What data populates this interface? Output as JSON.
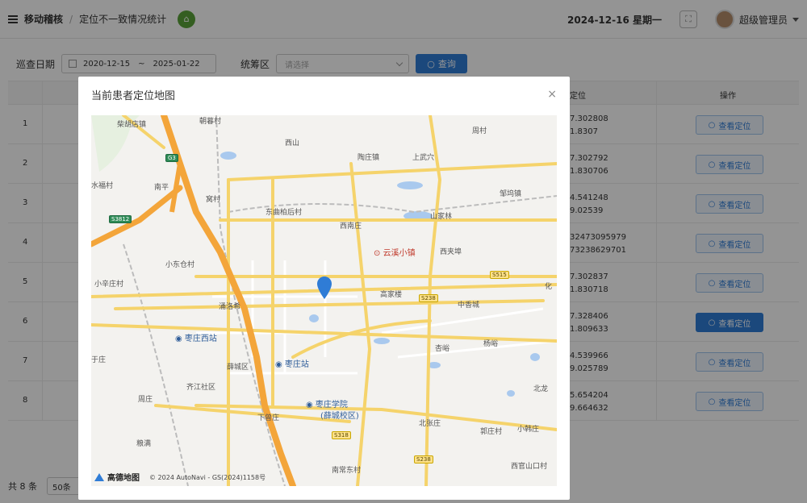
{
  "header": {
    "menu_label": "移动稽核",
    "breadcrumb_current": "定位不一致情况统计",
    "date": "2024-12-16 星期一",
    "user": "超级管理员"
  },
  "filters": {
    "date_label": "巡查日期",
    "date_start": "2020-12-15",
    "date_sep": "~",
    "date_end": "2025-01-22",
    "area_label": "统筹区",
    "area_placeholder": "请选择",
    "query_label": "查询"
  },
  "table": {
    "headers": {
      "position": "定位",
      "action": "操作"
    },
    "rows": [
      {
        "no": "1",
        "coord1": "7.302808",
        "coord2": "1.8307",
        "action": "查看定位"
      },
      {
        "no": "2",
        "coord1": "7.302792",
        "coord2": "1.830706",
        "action": "查看定位"
      },
      {
        "no": "3",
        "coord1": "4.541248",
        "coord2": "9.02539",
        "action": "查看定位"
      },
      {
        "no": "4",
        "coord1": "32473095979",
        "coord2": "73238629701",
        "action": "查看定位"
      },
      {
        "no": "5",
        "coord1": "7.302837",
        "coord2": "1.830718",
        "action": "查看定位"
      },
      {
        "no": "6",
        "coord1": "7.328406",
        "coord2": "1.809633",
        "action": "查看定位"
      },
      {
        "no": "7",
        "coord1": "4.539966",
        "coord2": "9.025789",
        "action": "查看定位"
      },
      {
        "no": "8",
        "coord1": "5.654204",
        "coord2": "9.664632",
        "action": "查看定位"
      }
    ]
  },
  "footer": {
    "total": "共 8 条",
    "page_size": "50条"
  },
  "modal": {
    "title": "当前患者定位地图",
    "close": "×",
    "map": {
      "places": [
        "柴胡店镇",
        "西山",
        "陶庄镇",
        "上武穴",
        "周村",
        "南平",
        "窝村",
        "东曲柏后村",
        "西南庄",
        "山家林",
        "邹坞镇",
        "云溪小镇",
        "西夹埠",
        "小东仓村",
        "小辛庄村",
        "高家楼",
        "中香城",
        "化",
        "涌洛希",
        "枣庄西站",
        "枣庄站",
        "杏峪",
        "杨峪",
        "薛城区",
        "于庄",
        "齐江社区",
        "枣庄学院",
        "(薛城校区)",
        "北龙",
        "周庄",
        "下曾庄",
        "北张庄",
        "郭庄村",
        "小韩庄",
        "粮满",
        "南常东村",
        "西官山口村",
        "朝暮村",
        "水福村"
      ],
      "roads": [
        "G3",
        "S3812",
        "S515",
        "S238",
        "S318",
        "S238"
      ],
      "brand": "高德地图",
      "copyright": "© 2024 AutoNavi - GS(2024)1158号"
    }
  }
}
